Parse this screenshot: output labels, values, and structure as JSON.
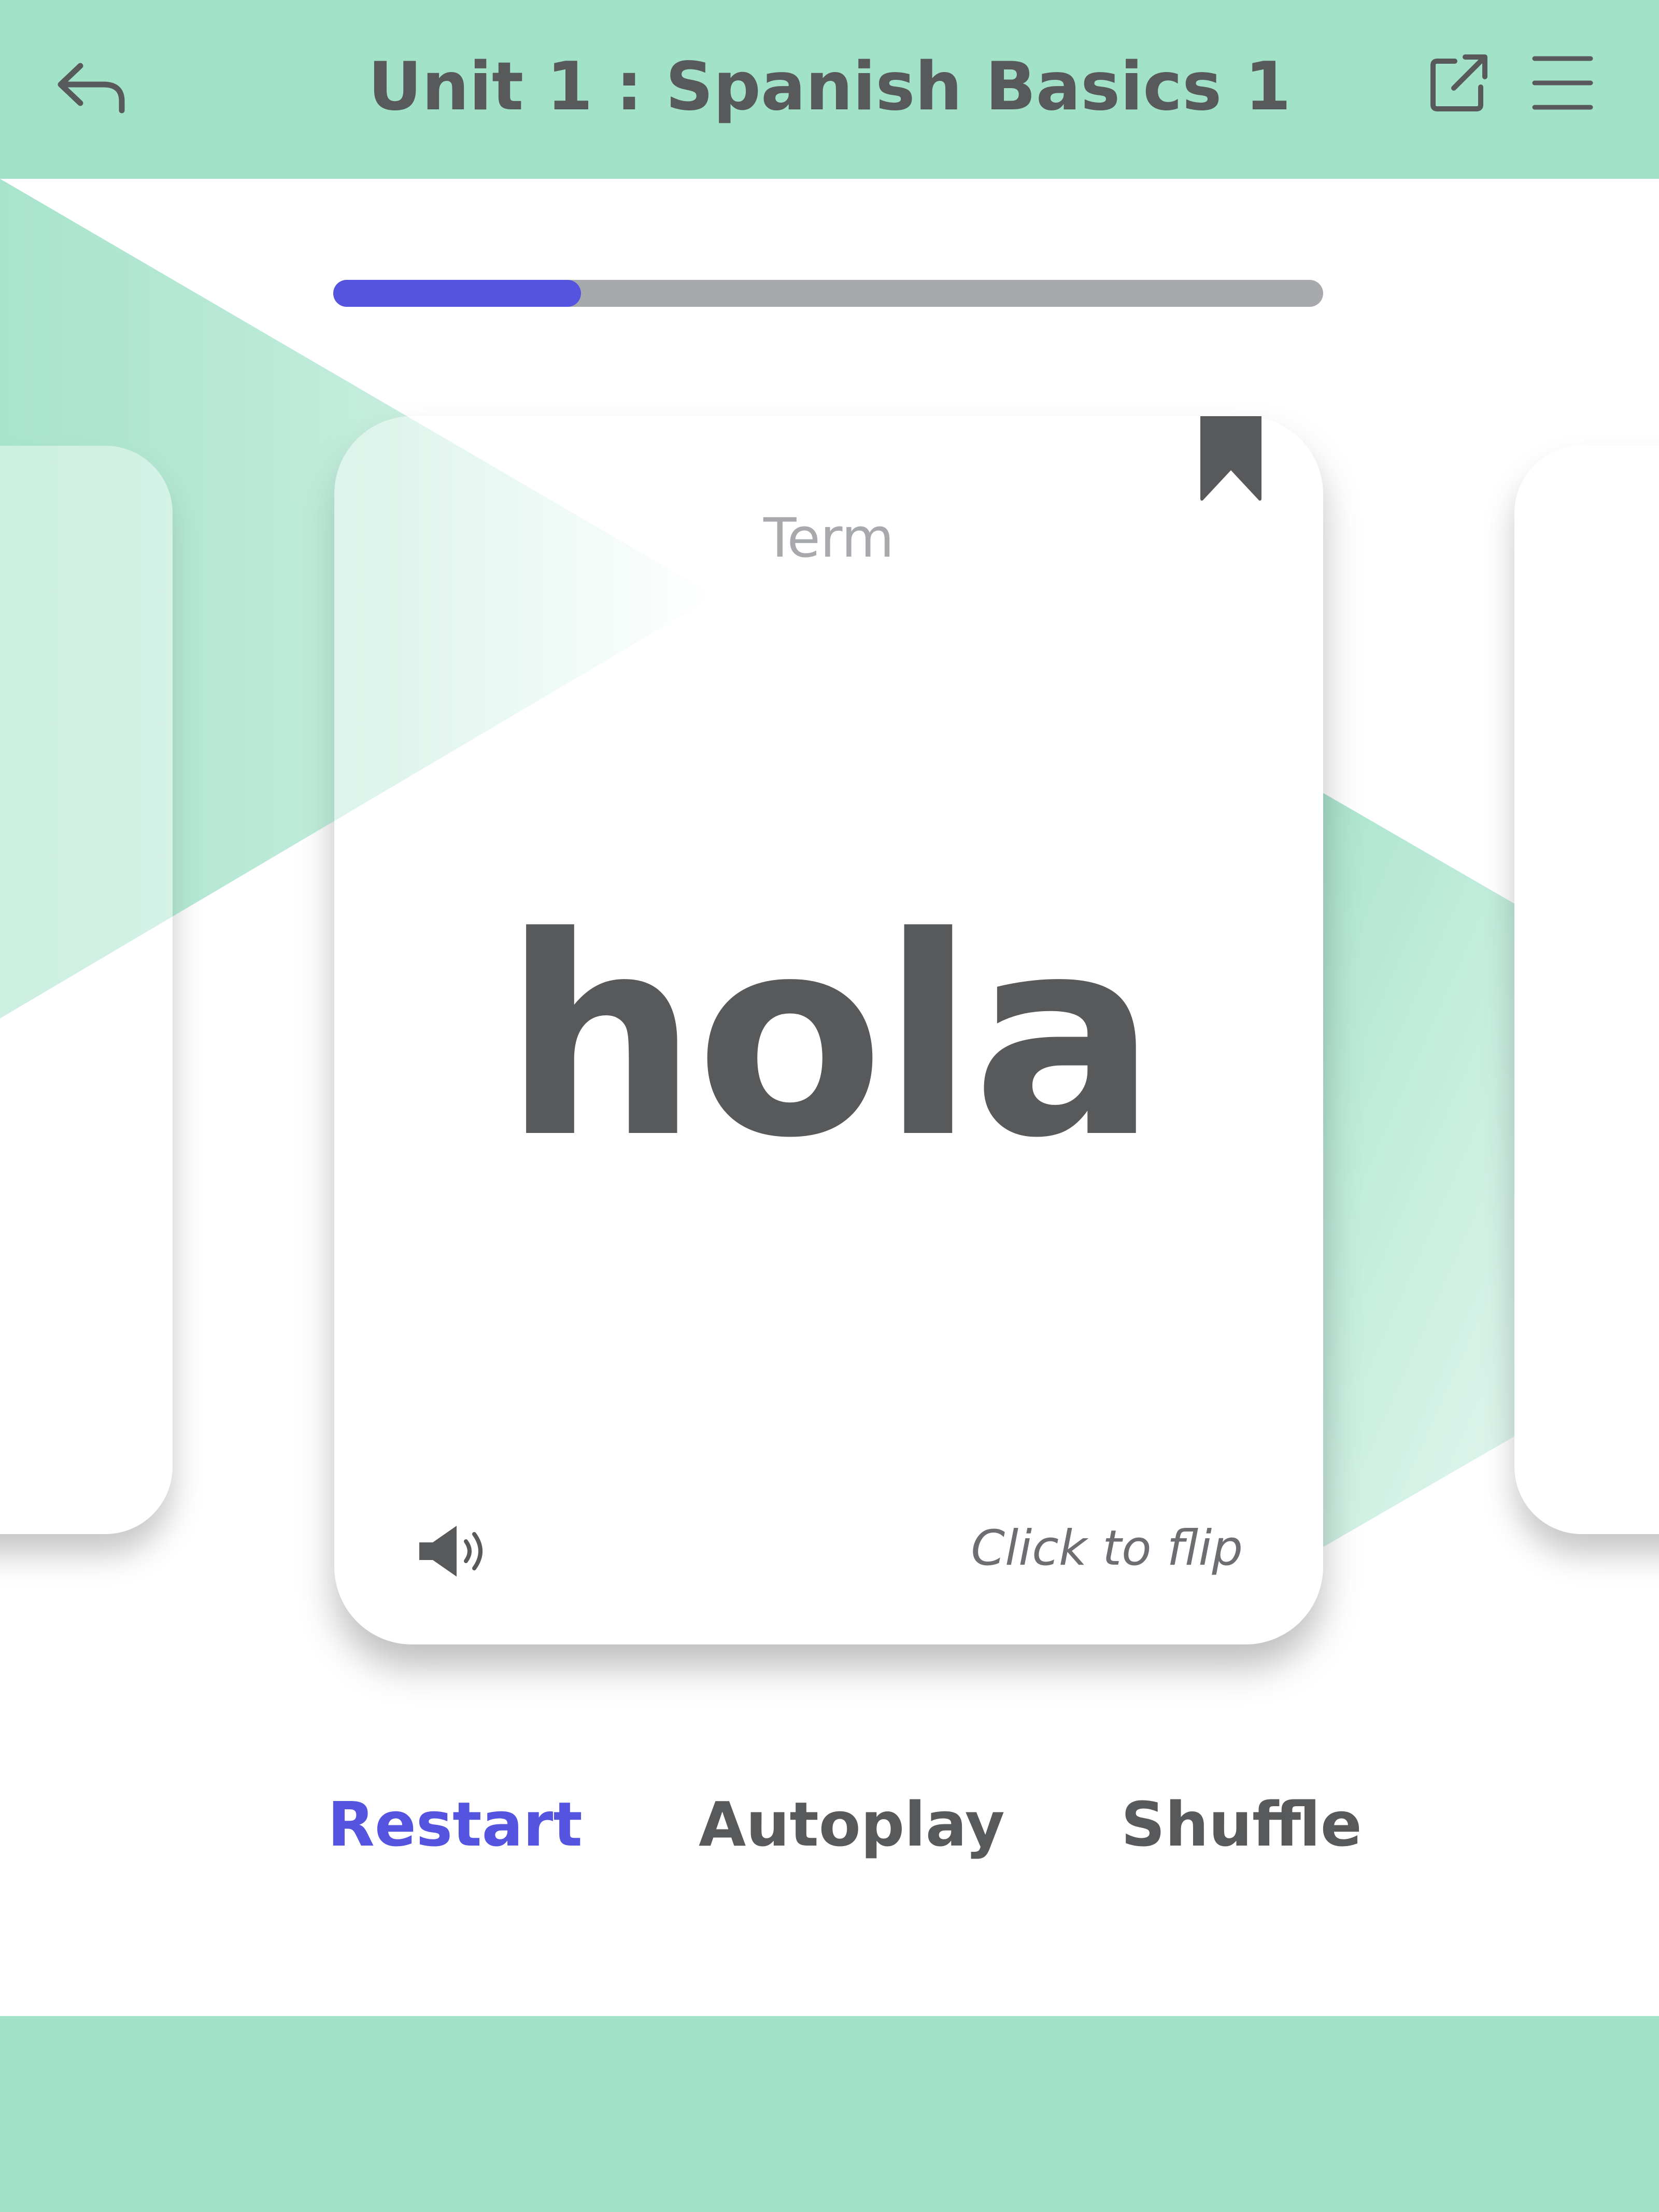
{
  "header": {
    "title": "Unit 1 : Spanish Basics 1"
  },
  "progress": {
    "fraction": 0.25
  },
  "flashcard": {
    "side_label": "Term",
    "term": "hola",
    "hint": "Click to flip"
  },
  "controls": {
    "restart": "Restart",
    "autoplay": "Autoplay",
    "shuffle": "Shuffle"
  },
  "icons": {
    "back": "back-arrow-icon",
    "share": "share-icon",
    "menu": "menu-icon",
    "bookmark": "bookmark-icon",
    "audio": "speaker-icon"
  },
  "colors": {
    "header_bg": "#a2e2c9",
    "accent": "#5454e0",
    "text": "#58595b",
    "muted": "#a7a9ac",
    "progress_track": "#a7a9ac"
  }
}
